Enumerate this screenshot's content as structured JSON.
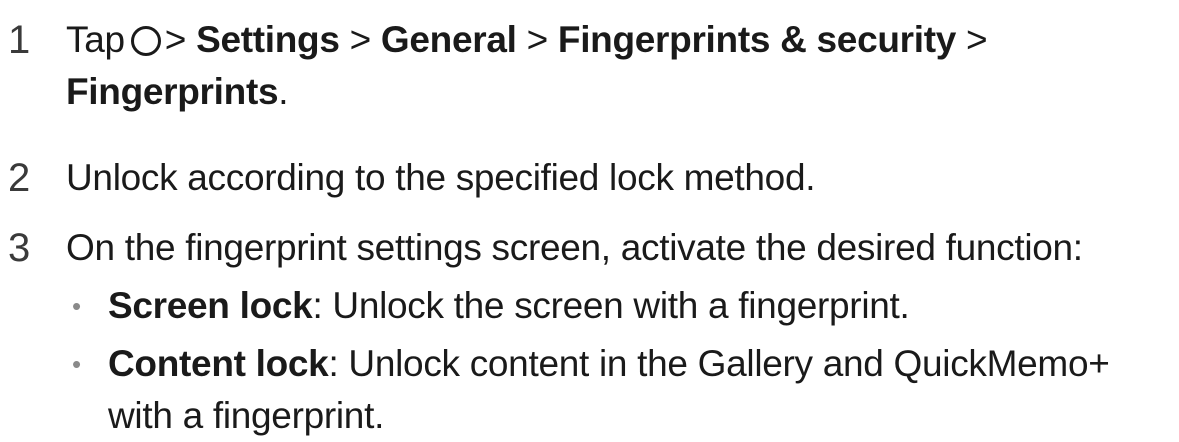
{
  "steps": [
    {
      "number": "1",
      "tap": "Tap",
      "home_icon": "home-circle-icon",
      "separator": ">",
      "path": [
        "Settings",
        "General",
        "Fingerprints & security",
        "Fingerprints"
      ],
      "end": "."
    },
    {
      "number": "2",
      "text": "Unlock according to the specified lock method."
    },
    {
      "number": "3",
      "text": "On the fingerprint settings screen, activate the desired function:",
      "options": [
        {
          "name": "Screen lock",
          "colon": ":",
          "description": " Unlock the screen with a fingerprint."
        },
        {
          "name": "Content lock",
          "colon": ":",
          "description": " Unlock content in the Gallery and QuickMemo+ with a fingerprint."
        }
      ]
    }
  ],
  "bullet_char": "•"
}
